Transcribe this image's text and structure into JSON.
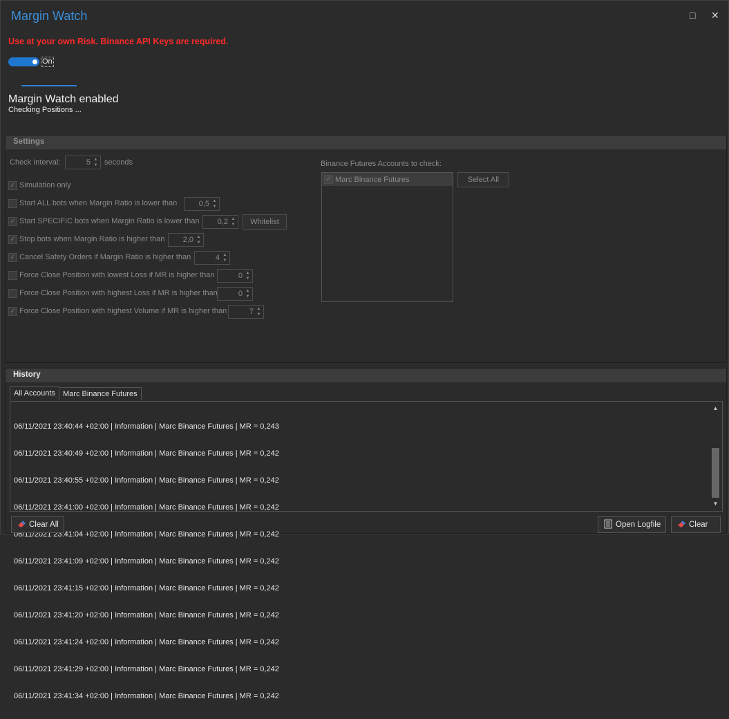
{
  "window": {
    "title": "Margin Watch",
    "maximize_icon": "□",
    "close_icon": "✕"
  },
  "warning": "Use at your own Risk. Binance API Keys are required.",
  "toggle": {
    "label": "On",
    "state": true,
    "color": "#1e78d2"
  },
  "status": {
    "title": "Margin Watch enabled",
    "subtitle": "Checking Positions ..."
  },
  "settings": {
    "header": "Settings",
    "check_interval": {
      "label": "Check Interval:",
      "value": "5",
      "unit": "seconds"
    },
    "simulation_only": {
      "label": "Simulation only",
      "checked": true
    },
    "options": [
      {
        "label": "Start ALL bots when Margin Ratio is lower than",
        "checked": false,
        "value": "0,5"
      },
      {
        "label": "Start SPECIFIC bots when Margin Ratio is lower than",
        "checked": true,
        "value": "0,2",
        "button": "Whitelist"
      },
      {
        "label": "Stop bots when Margin Ratio is higher than",
        "checked": true,
        "value": "2,0"
      },
      {
        "label": "Cancel Safety Orders if Margin Ratio is higher than",
        "checked": true,
        "value": "4"
      },
      {
        "label": "Force Close Position with lowest Loss if MR is higher than",
        "checked": false,
        "value": "0"
      },
      {
        "label": "Force Close Position with highest Loss if MR is higher than",
        "checked": false,
        "value": "0"
      },
      {
        "label": "Force Close Position with highest Volume if MR is higher than",
        "checked": true,
        "value": "7"
      }
    ],
    "accounts_label": "Binance Futures Accounts to check:",
    "accounts": [
      {
        "label": "Marc Binance Futures",
        "checked": true
      }
    ],
    "select_all": "Select All"
  },
  "history": {
    "header": "History",
    "tabs": [
      {
        "label": "All Accounts",
        "active": true
      },
      {
        "label": "Marc Binance Futures",
        "active": false
      }
    ],
    "log": [
      "06/11/2021 23:40:44 +02:00 | Information | Marc Binance Futures | MR = 0,243",
      "06/11/2021 23:40:49 +02:00 | Information | Marc Binance Futures | MR = 0,242",
      "06/11/2021 23:40:55 +02:00 | Information | Marc Binance Futures | MR = 0,242",
      "06/11/2021 23:41:00 +02:00 | Information | Marc Binance Futures | MR = 0,242",
      "06/11/2021 23:41:04 +02:00 | Information | Marc Binance Futures | MR = 0,242",
      "06/11/2021 23:41:09 +02:00 | Information | Marc Binance Futures | MR = 0,242",
      "06/11/2021 23:41:15 +02:00 | Information | Marc Binance Futures | MR = 0,242",
      "06/11/2021 23:41:20 +02:00 | Information | Marc Binance Futures | MR = 0,242",
      "06/11/2021 23:41:24 +02:00 | Information | Marc Binance Futures | MR = 0,242",
      "06/11/2021 23:41:29 +02:00 | Information | Marc Binance Futures | MR = 0,242",
      "06/11/2021 23:41:34 +02:00 | Information | Marc Binance Futures | MR = 0,242"
    ],
    "clear_all": "Clear All",
    "open_logfile": "Open Logfile",
    "clear": "Clear"
  },
  "icons": {
    "check": "✓",
    "eraser": "eraser-icon",
    "logfile": "logfile-icon"
  }
}
